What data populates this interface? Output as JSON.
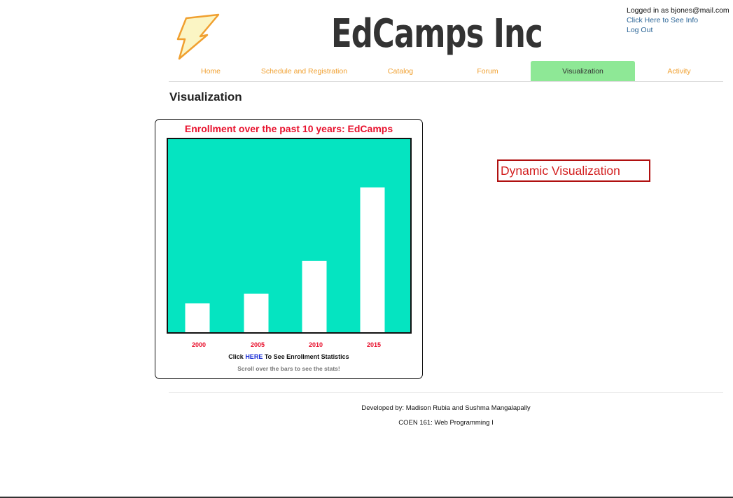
{
  "header": {
    "site_title": "EdCamps Inc",
    "logo_icon": "lightning-bolt-icon"
  },
  "account": {
    "logged_in_text": "Logged in as bjones@mail.com",
    "see_info_link": "Click Here to See Info",
    "logout_link": "Log Out"
  },
  "nav": {
    "tabs": [
      {
        "label": "Home",
        "active": false
      },
      {
        "label": "Schedule and Registration",
        "active": false
      },
      {
        "label": "Catalog",
        "active": false
      },
      {
        "label": "Forum",
        "active": false
      },
      {
        "label": "Visualization",
        "active": true
      },
      {
        "label": "Activity",
        "active": false
      }
    ]
  },
  "main": {
    "page_title": "Visualization",
    "click_prefix": "Click ",
    "click_link": "HERE",
    "click_suffix": " To See Enrollment Statistics",
    "hint": "Scroll over the bars to see the stats!",
    "dynamic_button": "Dynamic Visualization"
  },
  "chart_data": {
    "type": "bar",
    "title": "Enrollment over the past 10 years: EdCamps",
    "categories": [
      "2000",
      "2005",
      "2010",
      "2015"
    ],
    "values": [
      15,
      20,
      37,
      75
    ],
    "ylim": [
      0,
      100
    ],
    "xlabel": "",
    "ylabel": "",
    "grid": false,
    "colors": {
      "background": "#05e4c1",
      "bar": "#ffffff",
      "title": "#e8112d",
      "category_labels": "#e8112d"
    }
  },
  "footer": {
    "developers": "Developed by: Madison Rubia and Sushma Mangalapally",
    "course": "COEN 161: Web Programming I"
  },
  "colors": {
    "accent_tab": "#8ee896",
    "nav_text": "#f0a030",
    "link": "#2a6496",
    "dynamic_button_border": "#b01010"
  }
}
